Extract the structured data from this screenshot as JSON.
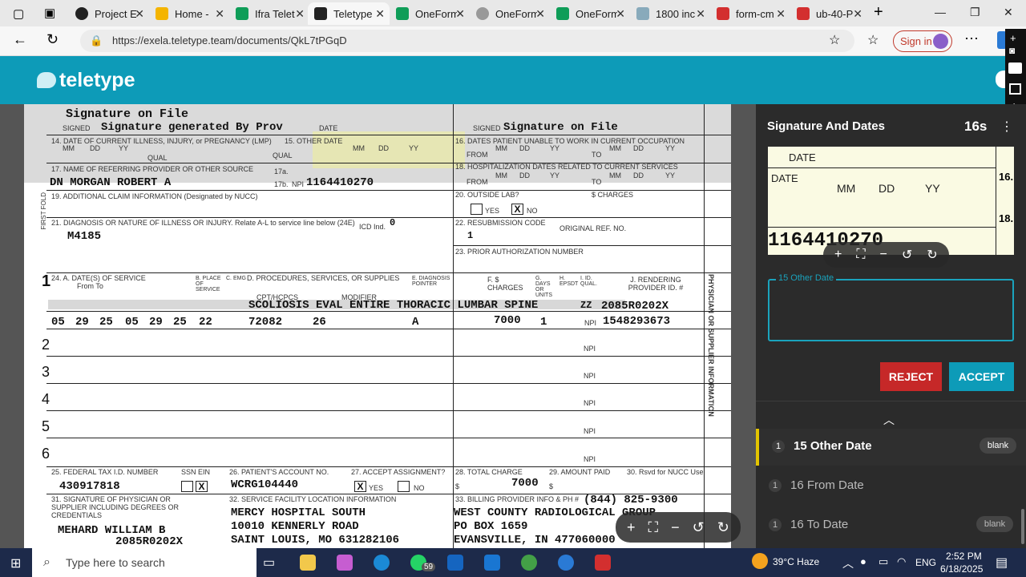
{
  "browser": {
    "tabs": [
      {
        "label": "Project E",
        "icon": "circle-icon"
      },
      {
        "label": "Home - ",
        "icon": "drive-icon"
      },
      {
        "label": "Ifra Telet",
        "icon": "sheets-icon"
      },
      {
        "label": "Teletype",
        "icon": "teletype-icon",
        "active": true
      },
      {
        "label": "OneForm",
        "icon": "sheets-icon"
      },
      {
        "label": "OneForm",
        "icon": "globe-icon"
      },
      {
        "label": "OneForm",
        "icon": "sheets-icon"
      },
      {
        "label": "1800 inc",
        "icon": "search-icon"
      },
      {
        "label": "form-cm",
        "icon": "pdf-icon"
      },
      {
        "label": "ub-40-P",
        "icon": "pdf-icon"
      }
    ],
    "url": "https://exela.teletype.team/documents/QkL7tPGqD",
    "sign_in": "Sign in"
  },
  "app": {
    "logo": "teletype"
  },
  "document": {
    "sig_top_left": "Signature on File",
    "signed_label": "SIGNED",
    "sig_generated": "Signature generated By Prov",
    "date_label": "DATE",
    "sig_top_right": "Signature on File",
    "box14": "14. DATE OF CURRENT ILLNESS, INJURY, or PREGNANCY (LMP)",
    "box15": "15. OTHER DATE",
    "box16": "16. DATES PATIENT UNABLE TO WORK IN CURRENT OCCUPATION",
    "mm": "MM",
    "dd": "DD",
    "yy": "YY",
    "qual": "QUAL",
    "from": "FROM",
    "to": "TO",
    "box17": "17. NAME OF REFERRING PROVIDER OR OTHER SOURCE",
    "box17_value": "DN MORGAN ROBERT A",
    "box17a": "17a.",
    "box17b": "17b.",
    "npi": "NPI",
    "box17b_value": "1164410270",
    "box18": "18. HOSPITALIZATION DATES RELATED TO CURRENT SERVICES",
    "box19": "19. ADDITIONAL CLAIM INFORMATION (Designated by NUCC)",
    "box20": "20. OUTSIDE LAB?",
    "charges": "$ CHARGES",
    "yes": "YES",
    "no": "NO",
    "x": "X",
    "box21": "21. DIAGNOSIS OR NATURE OF ILLNESS OR INJURY. Relate A-L to service line below (24E)",
    "icd": "ICD Ind.",
    "icd_value": "0",
    "dx_a": "M4185",
    "box22": "22. RESUBMISSION CODE",
    "box22_value": "1",
    "orig_ref": "ORIGINAL REF. NO.",
    "box23": "23. PRIOR AUTHORIZATION NUMBER",
    "box24_header": "24. A. DATE(S) OF SERVICE",
    "from_to": "From            To",
    "pos": "B. PLACE OF SERVICE",
    "emg": "C. EMG",
    "proc": "D. PROCEDURES, SERVICES, OR SUPPLIES",
    "dxptr": "E. DIAGNOSIS POINTER",
    "fcharges": "F. $ CHARGES",
    "gdays": "G. DAYS OR UNITS",
    "hepsdt": "H. EPSDT",
    "iqual": "I. ID. QUAL.",
    "jprov": "J. RENDERING PROVIDER ID. #",
    "cpt": "CPT/HCPCS",
    "modifier": "MODIFIER",
    "line1_desc": "SCOLIOSIS EVAL ENTIRE THORACIC  LUMBAR SPINE",
    "line1_shaded": "2085R0202X",
    "line1_qual": "ZZ",
    "line1": [
      "05",
      "29",
      "25",
      "05",
      "29",
      "25",
      "22",
      "72082",
      "26",
      "A",
      "7000",
      "1",
      "1548293673"
    ],
    "line_numbers": [
      "1",
      "2",
      "3",
      "4",
      "5",
      "6"
    ],
    "box25": "25. FEDERAL TAX I.D. NUMBER",
    "ssn_ein": "SSN  EIN",
    "box25_value": "430917818",
    "box26": "26. PATIENT'S ACCOUNT NO.",
    "box26_value": "WCRG104440",
    "box27": "27. ACCEPT ASSIGNMENT?",
    "box28": "28. TOTAL CHARGE",
    "box28_value": "7000",
    "box29": "29. AMOUNT PAID",
    "box30": "30. Rsvd for NUCC Use",
    "dollar": "$",
    "box31": "31. SIGNATURE OF PHYSICIAN OR SUPPLIER INCLUDING DEGREES OR CREDENTIALS",
    "box31_value": "MEHARD WILLIAM B",
    "box31_sub": "2085R0202X",
    "box32": "32. SERVICE FACILITY LOCATION INFORMATION",
    "box32_lines": [
      "MERCY HOSPITAL SOUTH",
      "10010 KENNERLY ROAD",
      "SAINT LOUIS, MO 631282106"
    ],
    "box33": "33. BILLING PROVIDER INFO & PH #",
    "box33_phone": "(844)  825-9300",
    "box33_lines": [
      "WEST COUNTY RADIOLOGICAL GROUP",
      "PO BOX 1659",
      "EVANSVILLE, IN 477060000"
    ],
    "side_label": "PHYSICIAN OR SUPPLIER INFORMATION",
    "left_label": "FIRST FOLD"
  },
  "panel": {
    "title": "Signature And Dates",
    "timer": "16s",
    "crop": {
      "date": "DATE",
      "date2": "DATE",
      "mm": "MM",
      "dd": "DD",
      "yy": "YY",
      "npi": "1164410270",
      "side16": "16.",
      "side18": "18."
    },
    "field_label": "15 Other Date",
    "field_value": "",
    "reject": "REJECT",
    "accept": "ACCEPT",
    "fields": [
      {
        "num": "1",
        "name": "15 Other Date",
        "badge": "blank",
        "active": true
      },
      {
        "num": "1",
        "name": "16 From Date",
        "badge": ""
      },
      {
        "num": "1",
        "name": "16 To Date",
        "badge": "blank"
      }
    ]
  },
  "taskbar": {
    "search": "Type here to search",
    "whatsapp_count": "59",
    "weather": "39°C  Haze",
    "lang": "ENG",
    "time": "2:52 PM",
    "date": "6/18/2025"
  },
  "colors": {
    "teal": "#0d9bb8",
    "reject": "#c62828",
    "panel": "#2b2b2b"
  }
}
